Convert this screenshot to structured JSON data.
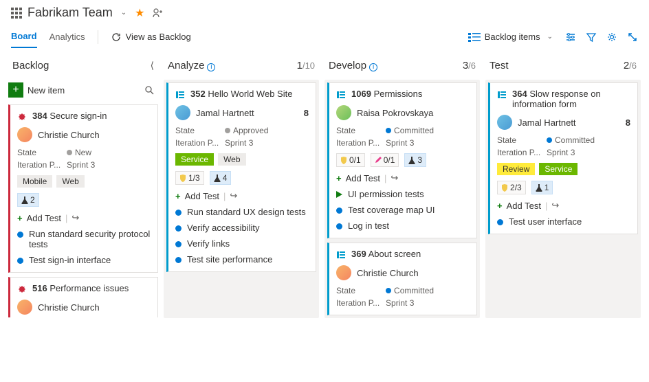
{
  "header": {
    "team": "Fabrikam Team"
  },
  "tabs": {
    "board": "Board",
    "analytics": "Analytics",
    "viewAs": "View as Backlog"
  },
  "toolbar": {
    "backlogItems": "Backlog items"
  },
  "columns": {
    "backlog": {
      "title": "Backlog",
      "newItem": "New item"
    },
    "analyze": {
      "title": "Analyze",
      "count": "1",
      "of": "/10"
    },
    "develop": {
      "title": "Develop",
      "count": "3",
      "of": "/6"
    },
    "test": {
      "title": "Test",
      "count": "2",
      "of": "/6"
    }
  },
  "labels": {
    "state": "State",
    "iteration": "Iteration P...",
    "addTest": "Add Test"
  },
  "cards": {
    "c384": {
      "id": "384",
      "title": "Secure sign-in",
      "assignee": "Christie Church",
      "state": "New",
      "iteration": "Sprint 3",
      "tags": [
        "Mobile",
        "Web"
      ],
      "flask": "2",
      "tests": [
        "Run standard security protocol tests",
        "Test sign-in interface"
      ]
    },
    "c516": {
      "id": "516",
      "title": "Performance issues",
      "assignee": "Christie Church"
    },
    "c352": {
      "id": "352",
      "title": "Hello World Web Site",
      "assignee": "Jamal Hartnett",
      "est": "8",
      "state": "Approved",
      "iteration": "Sprint 3",
      "tags": [
        "Service",
        "Web"
      ],
      "shield": "1/3",
      "flask": "4",
      "tests": [
        "Run standard UX design tests",
        "Verify accessibility",
        "Verify links",
        "Test site performance"
      ]
    },
    "c1069": {
      "id": "1069",
      "title": "Permissions",
      "assignee": "Raisa Pokrovskaya",
      "state": "Committed",
      "iteration": "Sprint 3",
      "shield": "0/1",
      "pencil": "0/1",
      "flask": "3",
      "tests": [
        "UI permission tests",
        "Test coverage map UI",
        "Log in test"
      ]
    },
    "c369": {
      "id": "369",
      "title": "About screen",
      "assignee": "Christie Church",
      "state": "Committed",
      "iteration": "Sprint 3"
    },
    "c364": {
      "id": "364",
      "title": "Slow response on information form",
      "assignee": "Jamal Hartnett",
      "est": "8",
      "state": "Committed",
      "iteration": "Sprint 3",
      "tags": [
        "Review",
        "Service"
      ],
      "shield": "2/3",
      "flask": "1",
      "tests": [
        "Test user interface"
      ]
    }
  }
}
